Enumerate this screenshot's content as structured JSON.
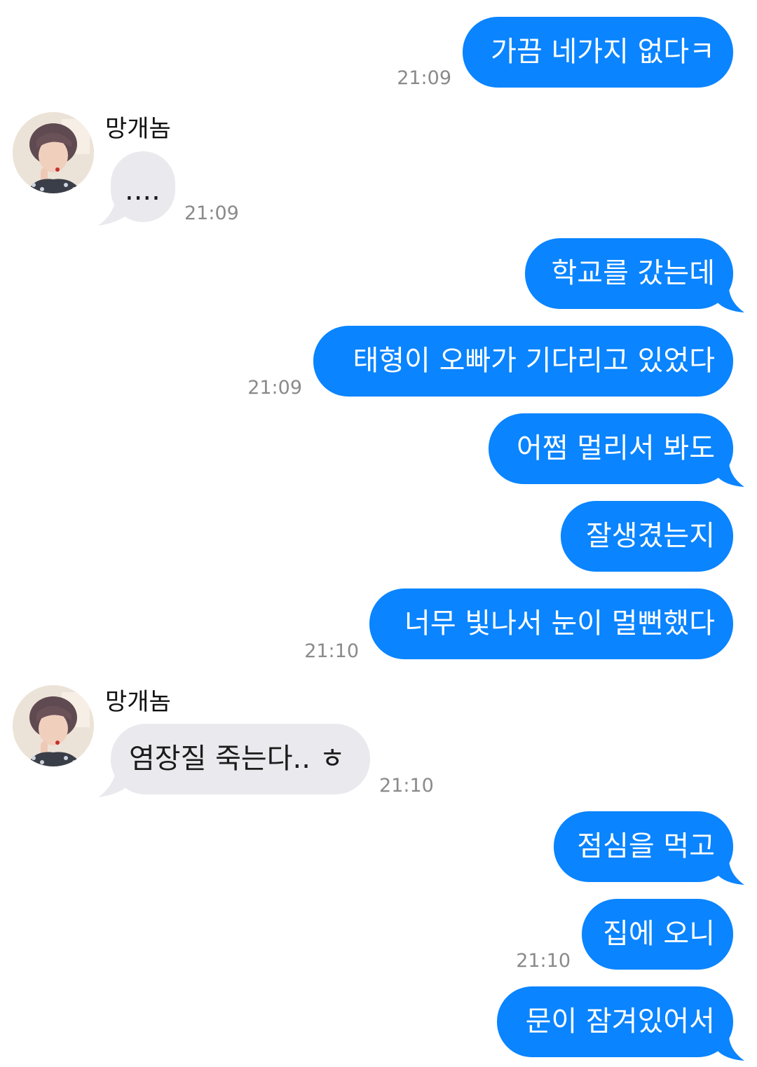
{
  "app": {
    "accent_color": "#0a84ff",
    "incoming_color": "#e9e9ee"
  },
  "messages": [
    {
      "type": "out",
      "text": "가끔 네가지 없다ㅋ",
      "time": "21:09"
    },
    {
      "type": "in",
      "sender": "망개놈",
      "text": "....",
      "time": "21:09",
      "avatar_icon": "profile-photo"
    },
    {
      "type": "out",
      "text": "학교를 갔는데"
    },
    {
      "type": "out",
      "text": "태형이 오빠가 기다리고 있었다",
      "time": "21:09"
    },
    {
      "type": "out",
      "text": "어쩜 멀리서 봐도"
    },
    {
      "type": "out",
      "text": "잘생겼는지"
    },
    {
      "type": "out",
      "text": "너무 빛나서 눈이 멀뻔했다",
      "time": "21:10"
    },
    {
      "type": "in",
      "sender": "망개놈",
      "text": "염장질 죽는다.. ㅎ",
      "time": "21:10",
      "avatar_icon": "profile-photo"
    },
    {
      "type": "out",
      "text": "점심을 먹고"
    },
    {
      "type": "out",
      "text": "집에 오니",
      "time": "21:10"
    },
    {
      "type": "out",
      "text": "문이 잠겨있어서"
    }
  ]
}
